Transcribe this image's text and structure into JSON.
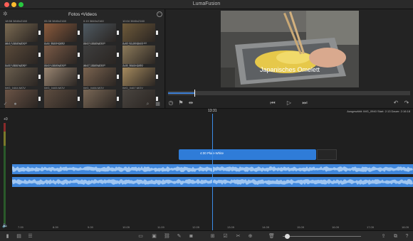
{
  "window": {
    "title": "LumaFusion"
  },
  "library": {
    "title": "Fotos •Videos",
    "clips": [
      {
        "cap1": "18:58  3840x2160",
        "cap2": "IMG_0454.MOV",
        "color": "#7a6a52"
      },
      {
        "cap1": "05:38  3840x2160",
        "cap2": "IMG_0457.MOV",
        "color": "#8a5a3c"
      },
      {
        "cap1": "0:19   3840x2160",
        "cap2": "IMG_0458.MOV",
        "color": "#4f5a62"
      },
      {
        "cap1": "10:04  3840x2160",
        "cap2": "IMG_0459.MOV",
        "color": "#6e5a3a"
      },
      {
        "cap1": "16:13  3840x2160",
        "cap2": "IMG_0462.MOV",
        "color": "#5a4a3a"
      },
      {
        "cap1": "2:14   3840x2160",
        "cap2": "IMG_0463.MOV",
        "color": "#7a5a46"
      },
      {
        "cap1": "28:03  3840x2160",
        "cap2": "IMG_0460.MOV",
        "color": "#3e3e3e"
      },
      {
        "cap1": "2:48:02  3840x2160",
        "cap2": "IMG_0461.MOV",
        "color": "#8c7a5a"
      },
      {
        "cap1": "3:119  3840x2160",
        "cap2": "IMG_0464.MOV",
        "color": "#6a5e4e"
      },
      {
        "cap1": "20:04  3840x2160",
        "cap2": "IMG_0465.MOV",
        "color": "#9a8672"
      },
      {
        "cap1": "16:27  3840x2160",
        "cap2": "IMG_0466.MOV",
        "color": "#7b6450"
      },
      {
        "cap1": "7:06   3840x2160",
        "cap2": "IMG_0467.MOV",
        "color": "#a58a5e"
      },
      {
        "cap1": "",
        "cap2": "",
        "color": "#6b5446"
      },
      {
        "cap1": "",
        "cap2": "",
        "color": "#5e4d40"
      },
      {
        "cap1": "",
        "cap2": "",
        "color": "#7a6856"
      },
      {
        "cap1": "",
        "cap2": "",
        "color": "#4a4540"
      }
    ]
  },
  "viewer": {
    "video_title": "Japanisches Omelett",
    "scrub_progress": 0.11
  },
  "timeline": {
    "meter_label": "+0",
    "playhead_time": "13:31",
    "info": "Ausgewählt: IMG_0940 Start: 2:13 Dauer: 2:16:18",
    "title_clip_label": "4:00   Plain-White",
    "ruler_labels": [
      "7.09",
      "8.09",
      "9.09",
      "10.09",
      "11.09",
      "12.09",
      "13.09",
      "14.09",
      "15.09",
      "16.09",
      "17.09",
      "18.09"
    ]
  },
  "toolbar": {
    "zoom_level": 0.05
  },
  "colors": {
    "accent": "#3b8de8",
    "audio": "#3f86db",
    "clip": "#2f7cd8"
  }
}
